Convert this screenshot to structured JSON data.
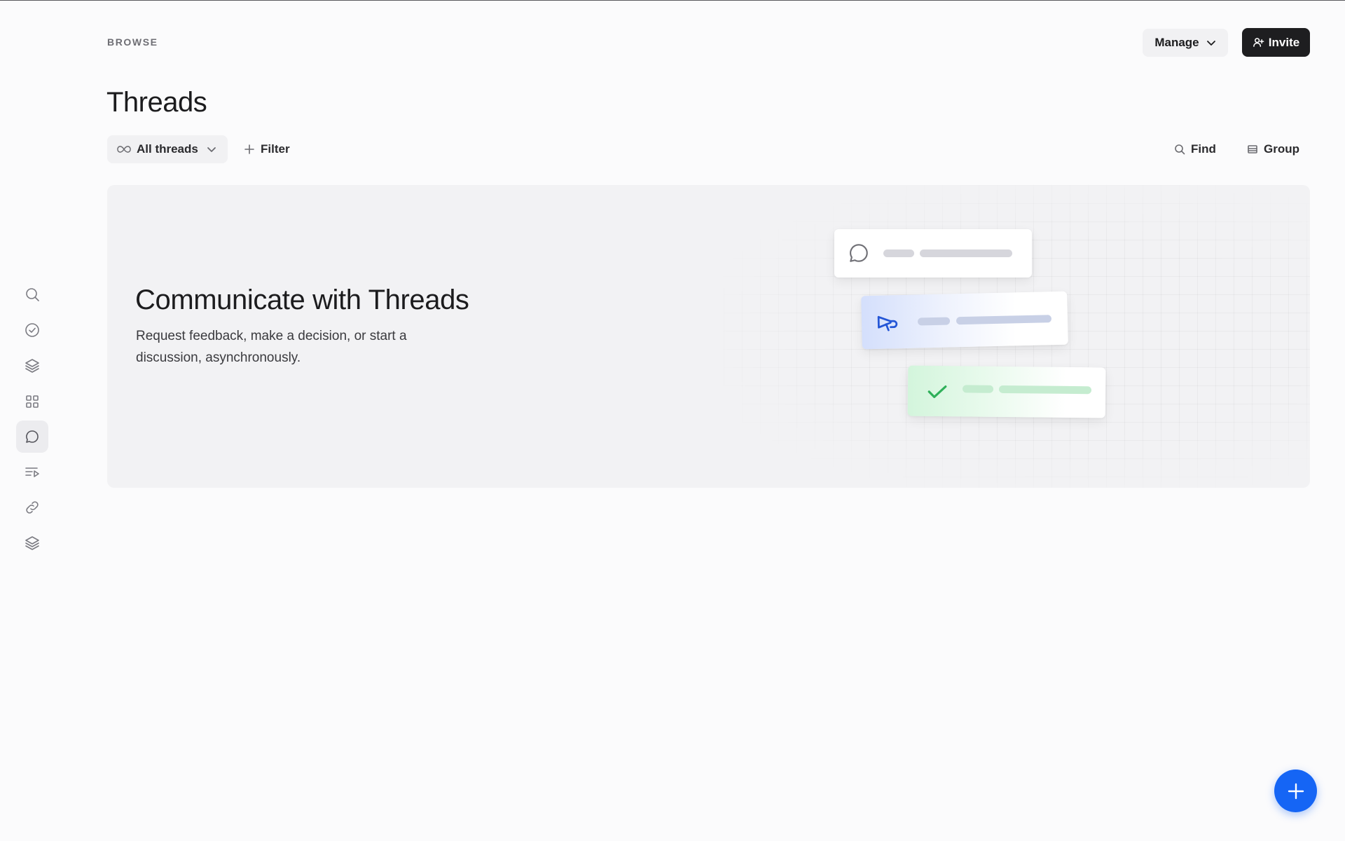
{
  "header": {
    "breadcrumb": "BROWSE",
    "title": "Threads",
    "manage_label": "Manage",
    "invite_label": "Invite"
  },
  "toolbar": {
    "view_label": "All threads",
    "filter_label": "Filter",
    "find_label": "Find",
    "group_label": "Group"
  },
  "sidebar": {
    "items": [
      {
        "icon": "search-icon"
      },
      {
        "icon": "check-circle-icon"
      },
      {
        "icon": "layers-icon"
      },
      {
        "icon": "grid-icon"
      },
      {
        "icon": "chat-bubble-icon",
        "active": true
      },
      {
        "icon": "list-play-icon"
      },
      {
        "icon": "link-icon"
      },
      {
        "icon": "layers-icon"
      }
    ]
  },
  "hero": {
    "title": "Communicate with Threads",
    "description": "Request feedback, make a decision, or start a discussion, asynchronously.",
    "illustration_icons": [
      "chat-bubble-icon",
      "megaphone-icon",
      "check-icon"
    ]
  },
  "colors": {
    "accent": "#1565f5",
    "invite_bg": "#1e1e20",
    "megaphone": "#2456d6",
    "check": "#2fb05a"
  }
}
